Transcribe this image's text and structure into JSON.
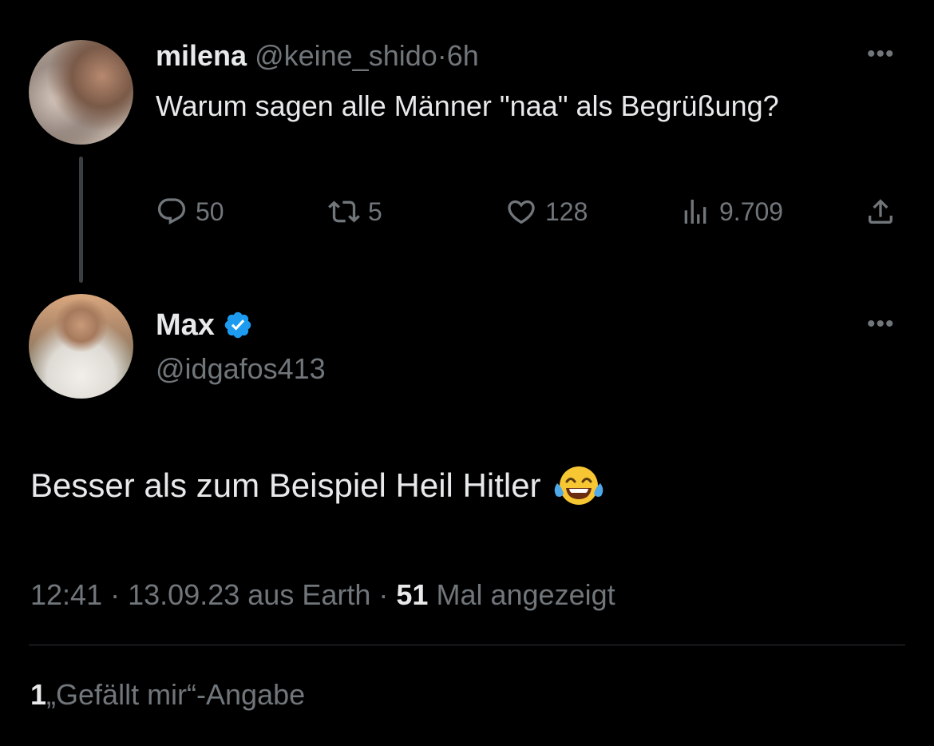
{
  "parent_tweet": {
    "author_name": "milena",
    "author_handle": "@keine_shido",
    "separator": "·",
    "time": "6h",
    "text": "Warum sagen alle Männer \"naa\" als Begrüßung?",
    "actions": {
      "replies": "50",
      "retweets": "5",
      "likes": "128",
      "views": "9.709"
    },
    "icons": [
      "reply-icon",
      "retweet-icon",
      "like-icon",
      "views-icon",
      "share-icon",
      "more-icon"
    ]
  },
  "reply_tweet": {
    "author_name": "Max",
    "author_handle": "@idgafos413",
    "verified": true,
    "text": "Besser als zum Beispiel Heil Hitler",
    "emoji": "face-with-tears-of-joy",
    "time": "12:41",
    "date": "13.09.23",
    "source": "aus Earth",
    "separator": "·",
    "views_count": "51",
    "views_label": "Mal angezeigt",
    "likes_count": "1",
    "likes_label": "„Gefällt mir“-Angabe"
  },
  "colors": {
    "background": "#000000",
    "text_primary": "#e7e9ea",
    "text_secondary": "#71767b",
    "verified_blue": "#1d9bf0",
    "divider": "#2f3336"
  }
}
